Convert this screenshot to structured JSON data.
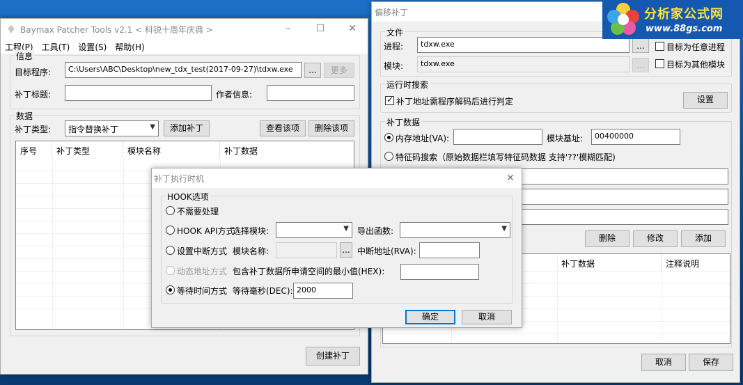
{
  "main": {
    "title": "Baymax Patcher Tools v2.1 < 科锐十周年庆典 >",
    "menu": [
      "工程(P)",
      "工具(T)",
      "设置(S)",
      "帮助(H)"
    ],
    "info": {
      "group_label": "信息",
      "target_label": "目标程序:",
      "target_value": "C:\\Users\\ABC\\Desktop\\new_tdx_test(2017-09-27)\\tdxw.exe",
      "browse_label": "...",
      "more_label": "更多",
      "patch_title_label": "补丁标题:",
      "patch_title_value": "",
      "author_label": "作者信息:",
      "author_value": ""
    },
    "data": {
      "group_label": "数据",
      "patch_type_label": "补丁类型:",
      "patch_type_value": "指令替换补丁",
      "add_patch": "添加补丁",
      "view_item": "查看该项",
      "delete_item": "删除该项",
      "columns": [
        "序号",
        "补丁类型",
        "模块名称",
        "补丁数据"
      ]
    },
    "create_patch": "创建补丁"
  },
  "offset": {
    "title": "偏移补丁",
    "file": {
      "group_label": "文件",
      "process_label": "进程:",
      "process_value": "tdxw.exe",
      "module_label": "模块:",
      "module_value": "tdxw.exe",
      "browse1": "...",
      "browse2": "...",
      "any_process": "目标为任意进程",
      "other_module": "目标为其他模块"
    },
    "runtime": {
      "group_label": "运行时搜索",
      "decode_check": "补丁地址需程序解码后进行判定",
      "settings": "设置"
    },
    "patchdata": {
      "group_label": "补丁数据",
      "mem_addr": "内存地址(VA):",
      "mem_value": "",
      "base_label": "模块基址:",
      "base_value": "00400000",
      "sig_search": "特征码搜索（原始数据栏填写特征码数据 支持'??'模糊匹配)",
      "delete": "删除",
      "modify": "修改",
      "add": "添加",
      "columns": [
        "补丁数据",
        "注释说明"
      ]
    },
    "cancel": "取消",
    "save": "保存"
  },
  "dialog": {
    "title": "补丁执行时机",
    "hook_group": "HOOK选项",
    "opt_none": "不需要处理",
    "opt_hookapi": "HOOK API方式",
    "select_module": "选择模块:",
    "export_func": "导出函数:",
    "opt_breakpoint": "设置中断方式",
    "module_name": "模块名称:",
    "browse": "...",
    "break_addr": "中断地址(RVA):",
    "opt_dynamic": "动态地址方式",
    "min_value": "包含补丁数据所申请空间的最小值(HEX):",
    "opt_wait": "等待时间方式",
    "wait_ms": "等待毫秒(DEC):",
    "wait_value": "2000",
    "ok": "确定",
    "cancel": "取消"
  },
  "logo": {
    "text1": "分析家公式网",
    "text2": "www.88gs.com"
  },
  "icons": [
    "app-icon",
    "minimize-icon",
    "maximize-icon",
    "close-icon",
    "chevron-down-icon",
    "flower-logo-icon"
  ]
}
